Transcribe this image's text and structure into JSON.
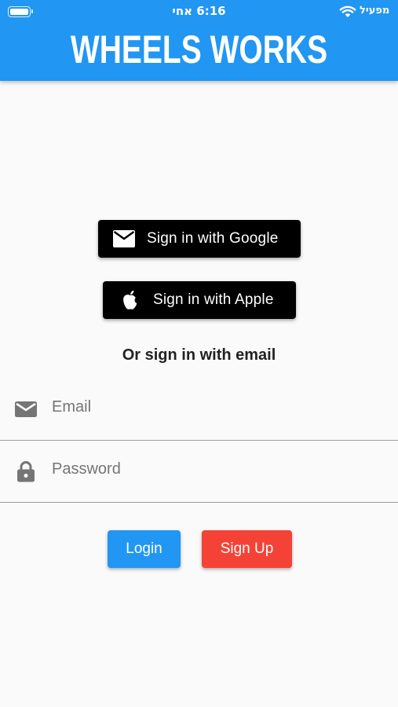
{
  "status_bar": {
    "time": "6:16 אחי",
    "carrier": "מפעיל",
    "icons": [
      "battery-icon",
      "wifi-icon"
    ]
  },
  "header": {
    "title": "WHEELS WORKS",
    "color": "#2196f3"
  },
  "social": {
    "google_label": "Sign in with Google",
    "google_icon": "mail-icon",
    "apple_label": "Sign in with Apple",
    "apple_icon": "apple-icon"
  },
  "divider_text": "Or sign in with email",
  "form": {
    "email": {
      "placeholder": "Email",
      "value": "",
      "icon": "mail-icon"
    },
    "password": {
      "placeholder": "Password",
      "value": "",
      "icon": "lock-icon"
    }
  },
  "actions": {
    "login_label": "Login",
    "login_color": "#2196f3",
    "signup_label": "Sign Up",
    "signup_color": "#f44336"
  }
}
